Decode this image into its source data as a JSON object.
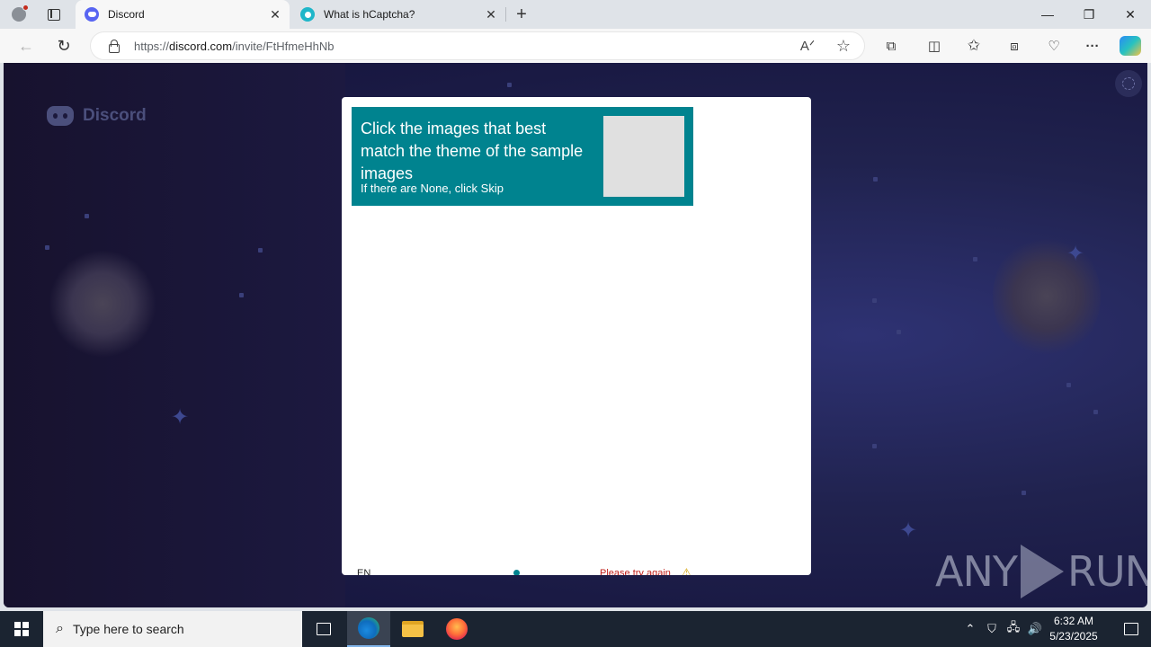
{
  "browser": {
    "tabs": [
      {
        "title": "Discord",
        "active": true,
        "close": "✕"
      },
      {
        "title": "What is hCaptcha?",
        "active": false,
        "close": "✕"
      }
    ],
    "new_tab": "+",
    "window": {
      "minimize": "—",
      "restore": "❐",
      "close": "✕"
    },
    "address": {
      "scheme": "https://",
      "host": "discord.com",
      "path": "/invite/FtHfmeHhNb"
    },
    "nav": {
      "back": "←",
      "reload": "↻"
    },
    "toolbar_icons": [
      "read-aloud-icon",
      "favorite-star-icon",
      "extensions-icon",
      "split-screen-icon",
      "favorites-icon",
      "collections-icon",
      "browser-essentials-icon",
      "more-icon",
      "copilot-icon"
    ],
    "glyphs": {
      "read_aloud": "A͏ᐟ",
      "star": "☆",
      "extensions": "⧉",
      "split": "◫",
      "favorites": "✩",
      "collections": "⧈",
      "essentials": "♡",
      "more": "···"
    }
  },
  "page": {
    "brand": "Discord",
    "captcha": {
      "prompt": "Click the images that best match the theme of the sample images",
      "subprompt": "If there are None, click Skip",
      "language": "EN",
      "error": "Please try again",
      "warning_icon": "⚠"
    },
    "watermark": {
      "left": "ANY",
      "right": "RUN"
    }
  },
  "taskbar": {
    "search_placeholder": "Type here to search",
    "time": "6:32 AM",
    "date": "5/23/2025",
    "tray_icons": [
      "chevron-up-icon",
      "security-icon",
      "network-icon",
      "volume-icon"
    ],
    "tray_glyphs": {
      "chevron": "⌃",
      "security": "⛉",
      "network": "🖧",
      "volume": "🔊"
    }
  },
  "colors": {
    "captcha_accent": "#00838f",
    "discord_brand": "#5865f2",
    "error": "#c0201a"
  }
}
